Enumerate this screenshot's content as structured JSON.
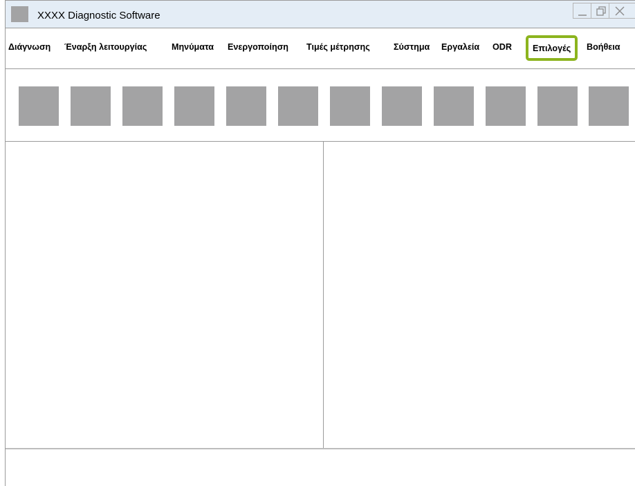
{
  "window": {
    "title": "XXXX Diagnostic Software",
    "controls": [
      "minimize-icon",
      "restore-icon",
      "close-icon"
    ]
  },
  "menu": {
    "items": [
      {
        "label": "Διάγνωση"
      },
      {
        "label": "Έναρξη λειτουργίας"
      },
      {
        "label": "Μηνύματα"
      },
      {
        "label": "Ενεργοποίηση"
      },
      {
        "label": "Τιμές μέτρησης"
      },
      {
        "label": "Σύστημα"
      },
      {
        "label": "Εργαλεία"
      },
      {
        "label": "ODR"
      },
      {
        "label": "Επιλογές",
        "highlighted": true
      },
      {
        "label": "Βοήθεια"
      }
    ],
    "highlight_color": "#8cb41e"
  },
  "toolbar": {
    "button_count": 12,
    "button_color": "#a3a3a4"
  },
  "colors": {
    "titlebar": "#e4edf6",
    "border": "#9a9a9a"
  }
}
